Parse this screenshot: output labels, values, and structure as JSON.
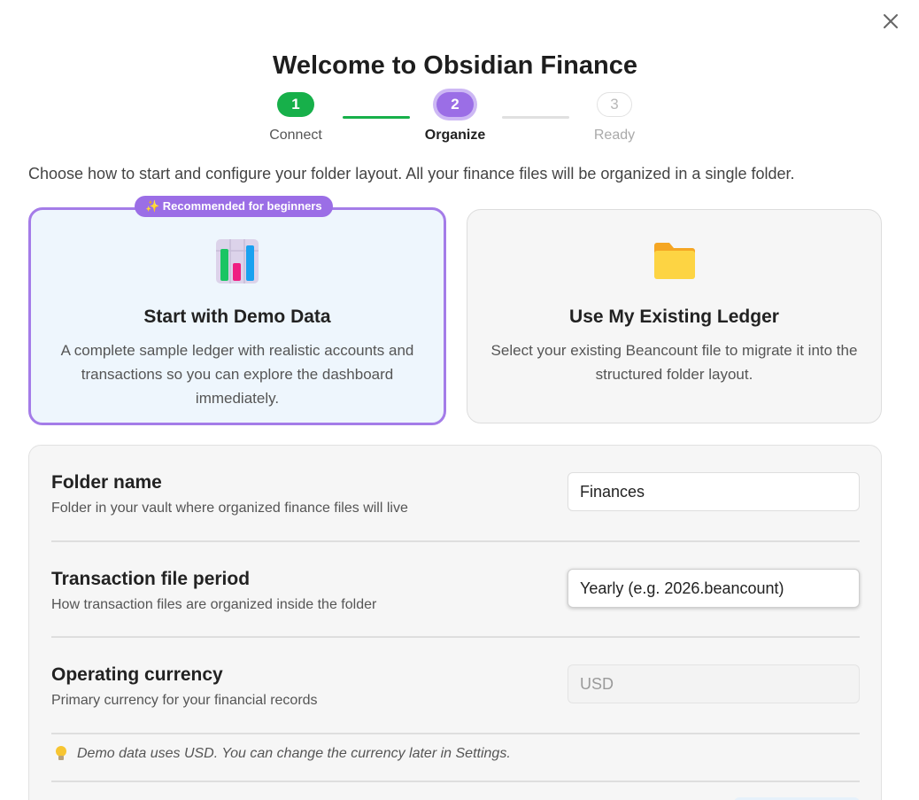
{
  "dialog": {
    "title": "Welcome to Obsidian Finance",
    "close_icon": "close-icon"
  },
  "steps": [
    {
      "number": "1",
      "label": "Connect",
      "state": "done"
    },
    {
      "number": "2",
      "label": "Organize",
      "state": "active"
    },
    {
      "number": "3",
      "label": "Ready",
      "state": "todo"
    }
  ],
  "intro": "Choose how to start and configure your folder layout. All your finance files will be organized in a single folder.",
  "options": [
    {
      "badge": "✨ Recommended for beginners",
      "icon": "bar-chart-icon",
      "title": "Start with Demo Data",
      "description": "A complete sample ledger with realistic accounts and transactions so you can explore the dashboard immediately.",
      "selected": true
    },
    {
      "icon": "folder-icon",
      "title": "Use My Existing Ledger",
      "description": "Select your existing Beancount file to migrate it into the structured folder layout.",
      "selected": false
    }
  ],
  "settings": {
    "folder_name": {
      "label": "Folder name",
      "description": "Folder in your vault where organized finance files will live",
      "value": "Finances"
    },
    "period": {
      "label": "Transaction file period",
      "description": "How transaction files are organized inside the folder",
      "value": "Yearly (e.g. 2026.beancount)"
    },
    "currency": {
      "label": "Operating currency",
      "description": "Primary currency for your financial records",
      "value": "USD"
    },
    "note": "Demo data uses USD. You can change the currency later in Settings."
  },
  "colors": {
    "accent": "#9b6ee6",
    "done": "#17b04a",
    "selected_card_bg": "#eef6fd"
  }
}
